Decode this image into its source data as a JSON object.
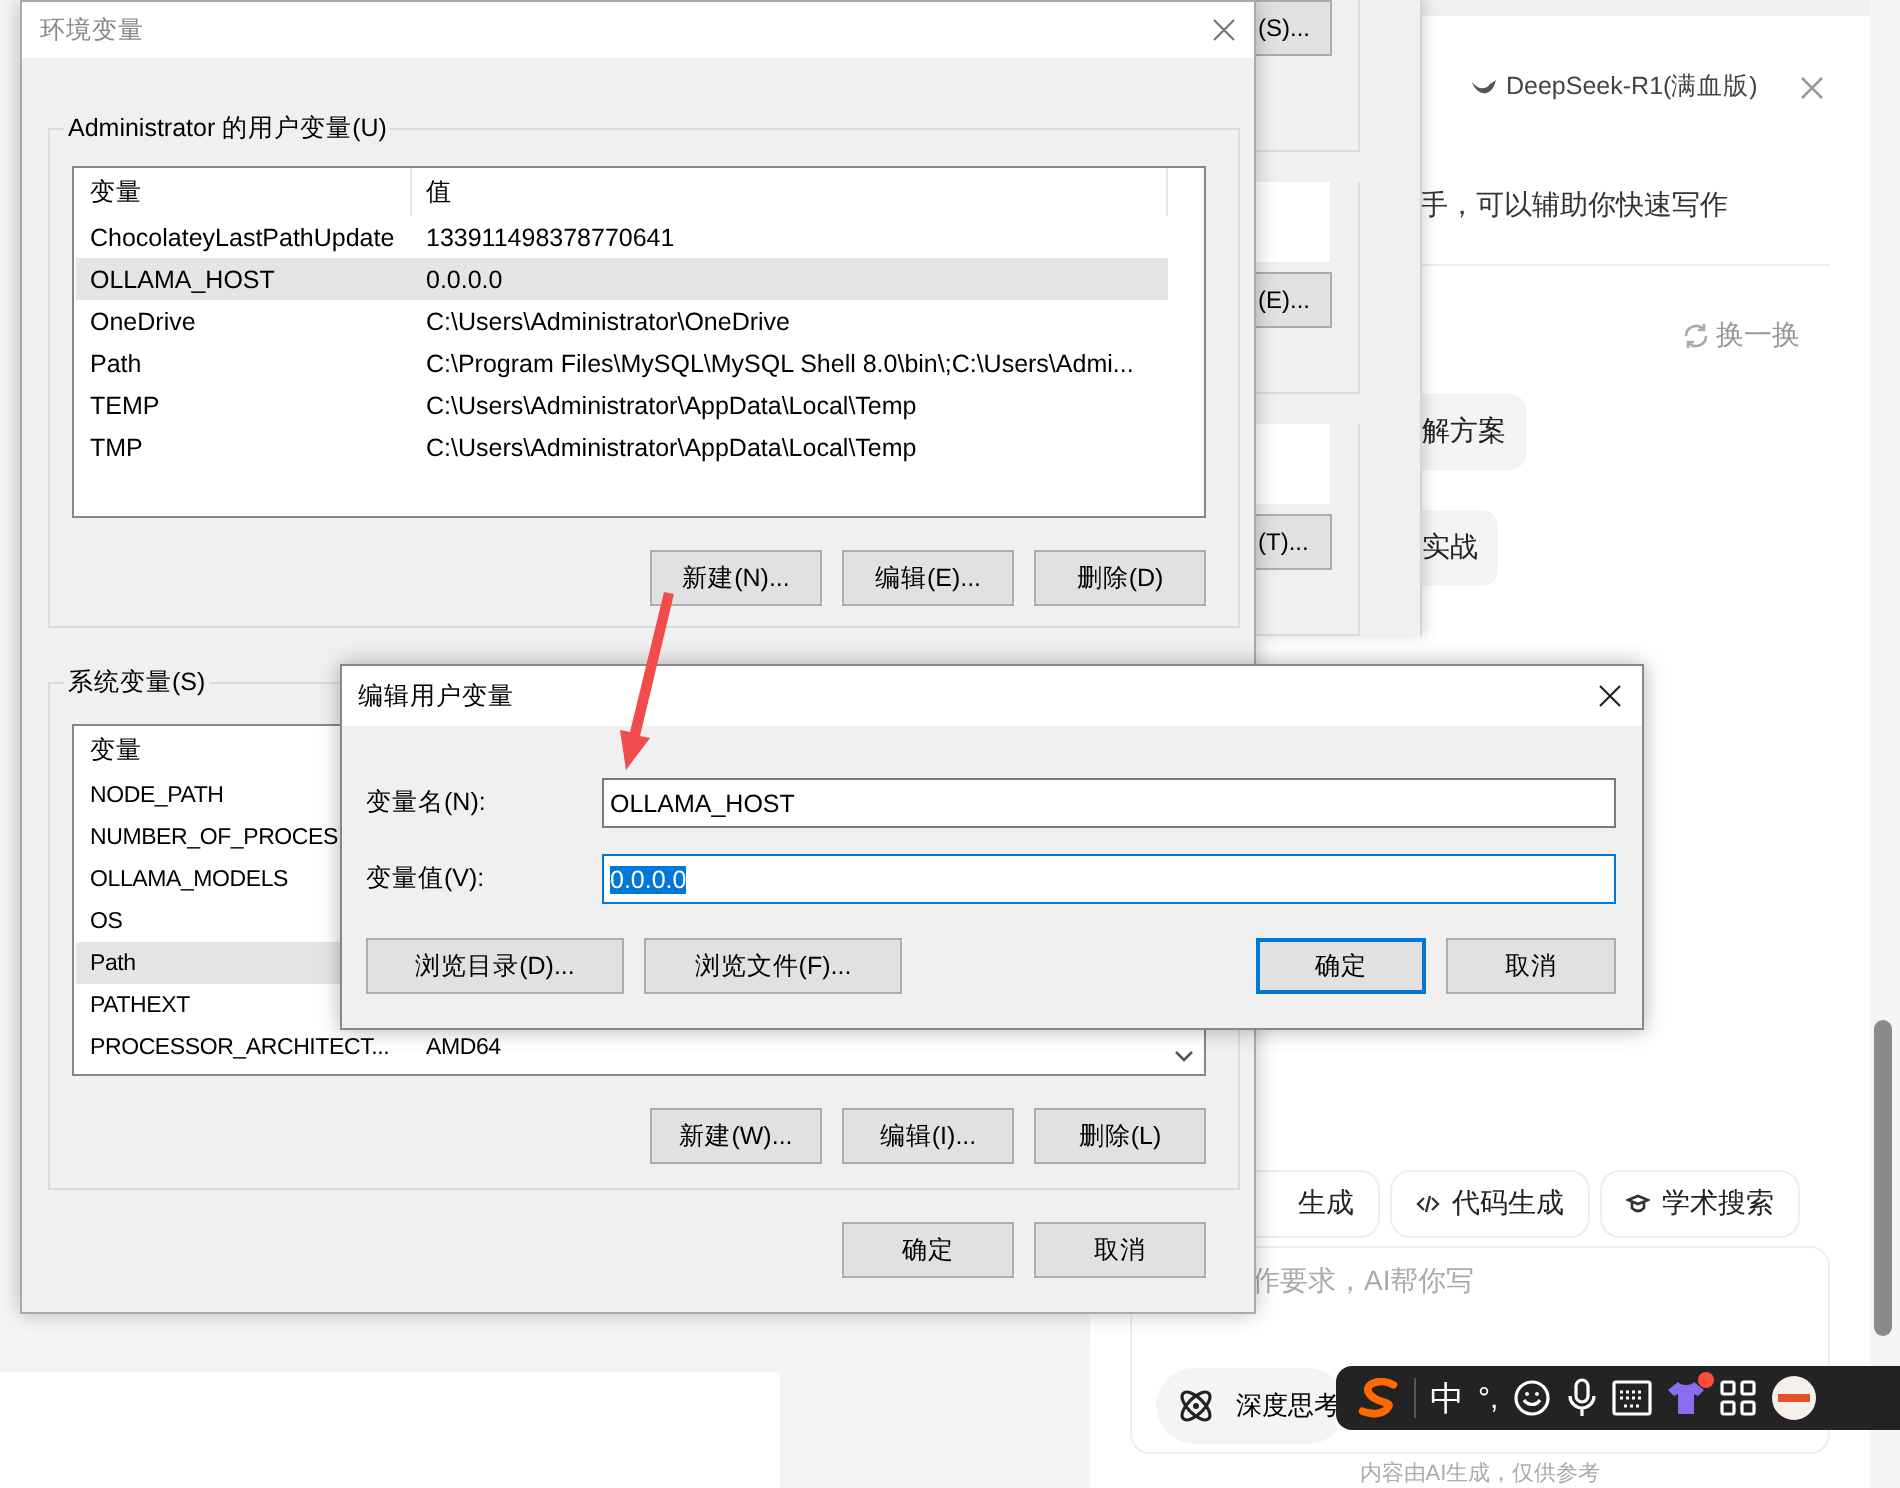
{
  "background_window": {
    "buttons": [
      "(S)...",
      "(E)...",
      "(T)..."
    ]
  },
  "assistant_panel": {
    "model": "DeepSeek-R1(满血版)",
    "intro": "手，可以辅助你快速写作",
    "refresh": "换一换",
    "suggestions": [
      "解方案",
      "实战"
    ],
    "tools": [
      "生成",
      "代码生成",
      "学术搜索"
    ],
    "input": {
      "placeholder": "作要求，AI帮你写"
    },
    "deep_think": "深度思考",
    "footer": "内容由AI生成，仅供参考"
  },
  "env_dialog": {
    "title": "环境变量",
    "user_group": {
      "label": "Administrator 的用户变量(U)",
      "columns": [
        "变量",
        "值"
      ],
      "rows": [
        {
          "name": "ChocolateyLastPathUpdate",
          "value": "133911498378770641",
          "selected": false
        },
        {
          "name": "OLLAMA_HOST",
          "value": "0.0.0.0",
          "selected": true
        },
        {
          "name": "OneDrive",
          "value": "C:\\Users\\Administrator\\OneDrive",
          "selected": false
        },
        {
          "name": "Path",
          "value": "C:\\Program Files\\MySQL\\MySQL Shell 8.0\\bin\\;C:\\Users\\Admi...",
          "selected": false
        },
        {
          "name": "TEMP",
          "value": "C:\\Users\\Administrator\\AppData\\Local\\Temp",
          "selected": false
        },
        {
          "name": "TMP",
          "value": "C:\\Users\\Administrator\\AppData\\Local\\Temp",
          "selected": false
        }
      ],
      "buttons": [
        "新建(N)...",
        "编辑(E)...",
        "删除(D)"
      ]
    },
    "system_group": {
      "label": "系统变量(S)",
      "columns": [
        "变量"
      ],
      "rows": [
        {
          "name": "NODE_PATH",
          "selected": false
        },
        {
          "name": "NUMBER_OF_PROCES",
          "selected": false
        },
        {
          "name": "OLLAMA_MODELS",
          "selected": false
        },
        {
          "name": "OS",
          "selected": false
        },
        {
          "name": "Path",
          "selected": true
        },
        {
          "name": "PATHEXT",
          "selected": false
        },
        {
          "name": "PROCESSOR_ARCHITECT...",
          "value": "AMD64",
          "selected": false
        }
      ],
      "buttons": [
        "新建(W)...",
        "编辑(I)...",
        "删除(L)"
      ]
    },
    "buttons": [
      "确定",
      "取消"
    ]
  },
  "edit_dialog": {
    "title": "编辑用户变量",
    "fields": [
      {
        "label": "变量名(N):",
        "value": "OLLAMA_HOST",
        "focused": false
      },
      {
        "label": "变量值(V):",
        "value": "0.0.0.0",
        "focused": true
      }
    ],
    "buttons": [
      {
        "label": "浏览目录(D)...",
        "default": false
      },
      {
        "label": "浏览文件(F)...",
        "default": false
      },
      {
        "label": "确定",
        "default": true
      },
      {
        "label": "取消",
        "default": false
      }
    ]
  },
  "ime_toolbar": {
    "mode": "中",
    "punctuation": "°,",
    "notification": true
  }
}
